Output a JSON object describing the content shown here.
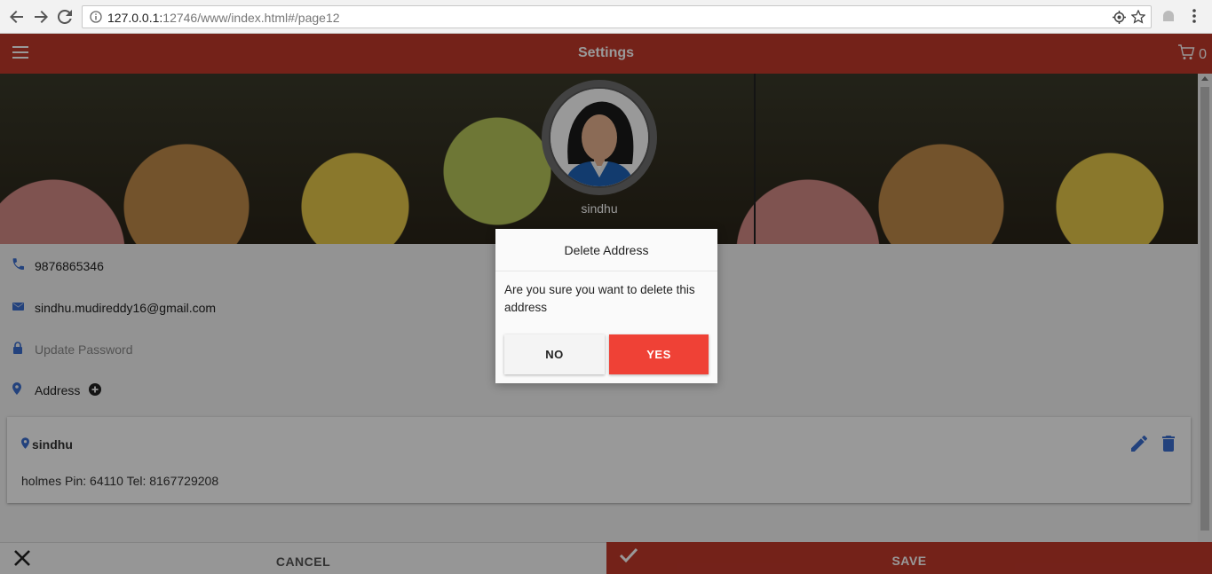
{
  "browser": {
    "url_host": "127.0.0.1:",
    "url_rest": "12746/www/index.html#/page12"
  },
  "header": {
    "title": "Settings",
    "cart_count": "0"
  },
  "profile": {
    "name": "sindhu"
  },
  "settings": {
    "phone": "9876865346",
    "email": "sindhu.mudireddy16@gmail.com",
    "password_placeholder": "Update Password",
    "address_label": "Address"
  },
  "address_card": {
    "name": "sindhu",
    "detail": "holmes Pin: 64110 Tel: 8167729208"
  },
  "footer": {
    "cancel_label": "CANCEL",
    "save_label": "SAVE"
  },
  "dialog": {
    "title": "Delete Address",
    "message": "Are you sure you want to delete this address",
    "no_label": "NO",
    "yes_label": "YES"
  },
  "colors": {
    "brand_red": "#c1392b",
    "icon_blue": "#3b6fd1",
    "yes_red": "#ef4136"
  }
}
